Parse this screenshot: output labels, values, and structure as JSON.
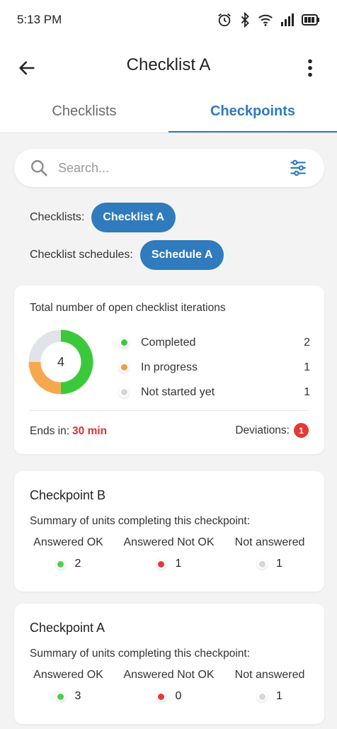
{
  "status_bar": {
    "time": "5:13 PM"
  },
  "app_bar": {
    "title": "Checklist A"
  },
  "tabs": [
    {
      "label": "Checklists"
    },
    {
      "label": "Checkpoints"
    }
  ],
  "search": {
    "placeholder": "Search..."
  },
  "filters": {
    "checklists_label": "Checklists:",
    "checklists_value": "Checklist A",
    "schedules_label": "Checklist schedules:",
    "schedules_value": "Schedule A"
  },
  "summary": {
    "title": "Total number of open checklist iterations",
    "total": "4",
    "legend": [
      {
        "label": "Completed",
        "count": "2",
        "color": "#3bc93b"
      },
      {
        "label": "In progress",
        "count": "1",
        "color": "#f39c3c"
      },
      {
        "label": "Not started yet",
        "count": "1",
        "color": "#d6d6d6"
      }
    ],
    "ends_label": "Ends in:",
    "ends_value": "30 min",
    "deviations_label": "Deviations:",
    "deviations_count": "1"
  },
  "checkpoint_columns": [
    "Answered OK",
    "Answered Not OK",
    "Not answered"
  ],
  "checkpoint_colors": [
    "#4cd04c",
    "#e53935",
    "#d6d6d6"
  ],
  "checkpoints": [
    {
      "title": "Checkpoint B",
      "subtitle": "Summary of units completing this checkpoint:",
      "values": [
        "2",
        "1",
        "1"
      ]
    },
    {
      "title": "Checkpoint A",
      "subtitle": "Summary of units completing this checkpoint:",
      "values": [
        "3",
        "0",
        "1"
      ]
    }
  ]
}
